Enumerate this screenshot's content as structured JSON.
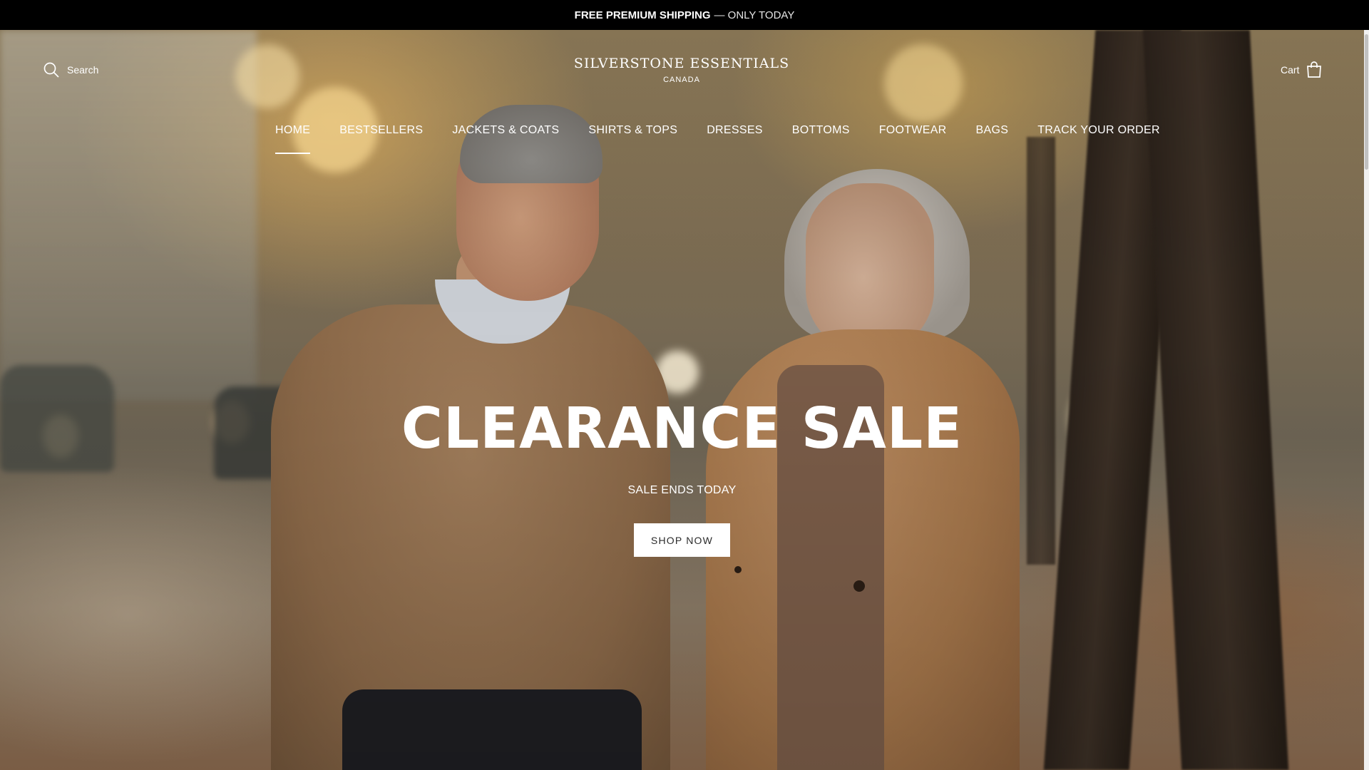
{
  "announcement": {
    "bold": "FREE PREMIUM SHIPPING",
    "rest": "— ONLY TODAY"
  },
  "header": {
    "search_label": "Search",
    "logo_line1": "SILVERSTONE ESSENTIALS",
    "logo_line2": "CANADA",
    "cart_label": "Cart",
    "search_icon": "search-icon",
    "cart_icon": "shopping-bag-icon"
  },
  "nav": {
    "items": [
      {
        "label": "HOME",
        "active": true
      },
      {
        "label": "BESTSELLERS"
      },
      {
        "label": "JACKETS & COATS"
      },
      {
        "label": "SHIRTS & TOPS"
      },
      {
        "label": "DRESSES"
      },
      {
        "label": "BOTTOMS"
      },
      {
        "label": "FOOTWEAR"
      },
      {
        "label": "BAGS"
      },
      {
        "label": "TRACK YOUR ORDER"
      }
    ]
  },
  "hero": {
    "headline": "CLEARANCE SALE",
    "subheadline": "SALE ENDS TODAY",
    "cta_label": "SHOP NOW"
  },
  "colors": {
    "announcement_bg": "#000000",
    "text": "#ffffff",
    "button_bg": "#ffffff",
    "button_text": "#2b2b2b"
  }
}
